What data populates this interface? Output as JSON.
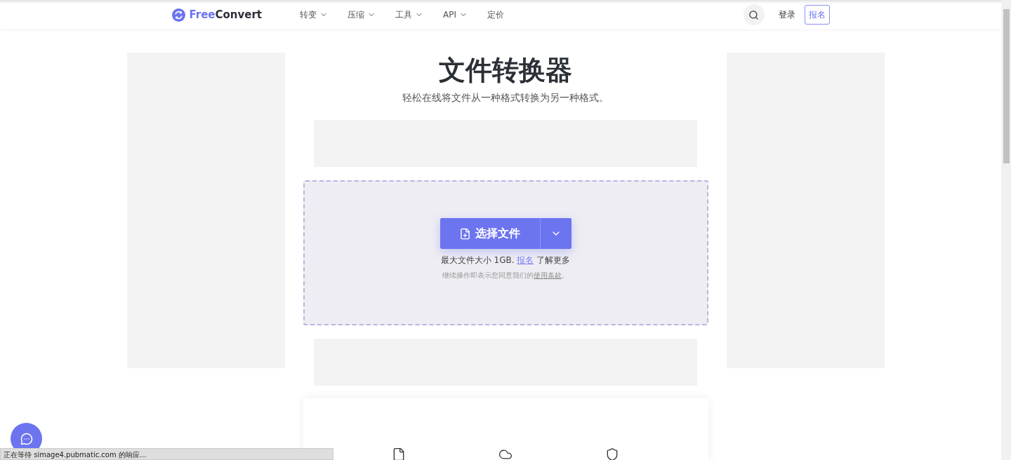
{
  "header": {
    "logo": {
      "accent": "Free",
      "rest": "Convert"
    },
    "nav": [
      {
        "label": "转变",
        "dropdown": true
      },
      {
        "label": "压缩",
        "dropdown": true
      },
      {
        "label": "工具",
        "dropdown": true
      },
      {
        "label": "API",
        "dropdown": true
      },
      {
        "label": "定价",
        "dropdown": false
      }
    ],
    "login": "登录",
    "signup": "报名"
  },
  "hero": {
    "title": "文件转换器",
    "subtitle": "轻松在线将文件从一种格式转换为另一种格式。"
  },
  "upload": {
    "button": "选择文件",
    "info": {
      "before": "最大文件大小 1GB. ",
      "link": "报名",
      "after": " 了解更多"
    },
    "terms": {
      "before": "继续操作即表示您同意我们的",
      "link": "使用条款",
      "after": "。"
    }
  },
  "features": [
    {
      "kind": "file"
    },
    {
      "kind": "cloud"
    },
    {
      "kind": "shield"
    }
  ],
  "status_bar": "正在等待 simage4.pubmatic.com 的响应..."
}
